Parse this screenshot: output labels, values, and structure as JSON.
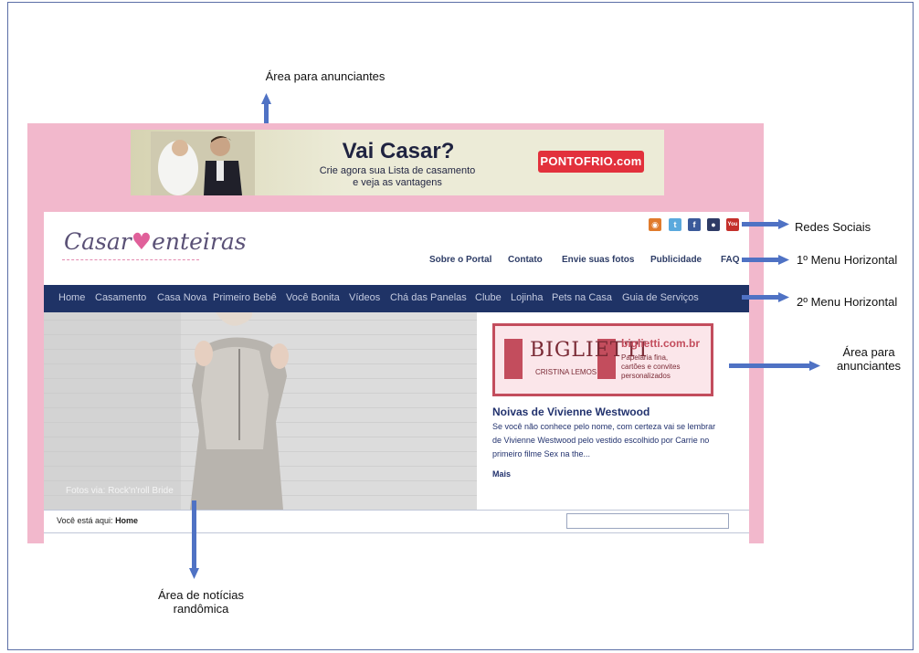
{
  "annotations": {
    "top_ads": "Área para anunciantes",
    "social": "Redes Sociais",
    "menu1": "1º Menu Horizontal",
    "menu2": "2º Menu Horizontal",
    "side_ads_line1": "Área para",
    "side_ads_line2": "anunciantes",
    "news_line1": "Área de notícias",
    "news_line2": "randômica"
  },
  "top_ad": {
    "headline": "Vai Casar?",
    "line1": "Crie agora sua Lista de casamento",
    "line2": "e veja as vantagens",
    "brand": "PONTOFRIO.com"
  },
  "header": {
    "logo_left": "Casar",
    "logo_right": "enteiras",
    "social_icons": [
      "rss-icon",
      "twitter-icon",
      "facebook-icon",
      "orkut-icon",
      "youtube-icon"
    ],
    "menu1": [
      "Sobre o Portal",
      "Contato",
      "Envie suas fotos",
      "Publicidade",
      "FAQ"
    ]
  },
  "nav2": [
    "Home",
    "Casamento",
    "Casa Nova",
    "Primeiro Bebê",
    "Você Bonita",
    "Vídeos",
    "Chá das Panelas",
    "Clube",
    "Lojinha",
    "Pets na Casa",
    "Guia de Serviços"
  ],
  "hero": {
    "caption": "Fotos via: Rock'n'roll Bride"
  },
  "side_ad": {
    "logo": "BIGLIETTI",
    "logo_sub": "CRISTINA LEMOS",
    "url": "biglietti.com.br",
    "desc1": "Papelaria fina,",
    "desc2": "cartões e convites",
    "desc3": "personalizados"
  },
  "news": {
    "title": "Noivas de Vivienne Westwood",
    "body": "Se você não conhece pelo nome, com certeza vai se lembrar de Vivienne Westwood pelo vestido escolhido por Carrie no primeiro filme Sex na the...",
    "more": "Mais"
  },
  "breadcrumb": {
    "prefix": "Você está aqui:",
    "current": "Home",
    "search_value": ""
  },
  "colors": {
    "page_pink": "#f2b8cc",
    "nav_blue": "#1f3366",
    "arrow_blue": "#4f72c4",
    "ad_red": "#e2313c"
  }
}
